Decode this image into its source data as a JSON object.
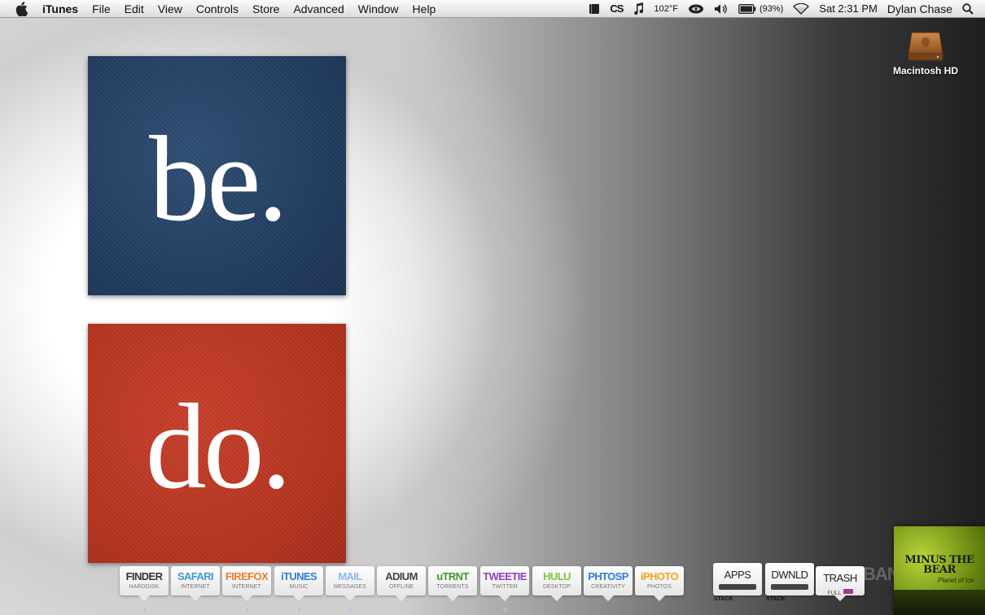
{
  "menubar": {
    "apple_icon": "apple-logo-icon",
    "app_name": "iTunes",
    "menus": [
      "File",
      "Edit",
      "View",
      "Controls",
      "Store",
      "Advanced",
      "Window",
      "Help"
    ],
    "status": {
      "cs_label": "CS",
      "temperature": "102°F",
      "battery": "(93%)",
      "clock": "Sat 2:31 PM",
      "user": "Dylan Chase"
    }
  },
  "desktop": {
    "poster_top_word": "be.",
    "poster_bottom_word": "do.",
    "poster_top_color": "#1f3a5c",
    "poster_bottom_color": "#b3331f",
    "drive_label": "Macintosh HD"
  },
  "dock": {
    "apps": [
      {
        "label": "FINDER",
        "sub": "HARDDISK",
        "color": "#333333"
      },
      {
        "label": "SAFARI",
        "sub": "INTERNET",
        "color": "#3f9ad8"
      },
      {
        "label": "FIREFOX",
        "sub": "INTERNET",
        "color": "#f07a25"
      },
      {
        "label": "iTUNES",
        "sub": "MUSIC",
        "color": "#2f7fd6"
      },
      {
        "label": "MAIL",
        "sub": "MESSAGES",
        "color": "#8fb9e8"
      },
      {
        "label": "ADIUM",
        "sub": "OFFLINE",
        "color": "#444444"
      },
      {
        "label": "uTRNT",
        "sub": "TORRENTS",
        "color": "#3d9a2b"
      },
      {
        "label": "TWEETIE",
        "sub": "TWITTER",
        "color": "#8e3fc4"
      },
      {
        "label": "HULU",
        "sub": "DESKTOP",
        "color": "#7dc242"
      },
      {
        "label": "PHTOSP",
        "sub": "CREATIVITY",
        "color": "#2f7fd6"
      },
      {
        "label": "iPHOTO",
        "sub": "PHOTOS",
        "color": "#f2a51f"
      }
    ],
    "stacks": [
      {
        "label": "APPS",
        "tag": "STACK"
      },
      {
        "label": "DWNLD",
        "tag": "STACK"
      }
    ],
    "trash": {
      "label": "TRASH",
      "sub": "FULL"
    },
    "watermark": "BANG",
    "album": {
      "title": "MINUS THE BEAR",
      "subtitle": "Planet of Ice"
    }
  }
}
